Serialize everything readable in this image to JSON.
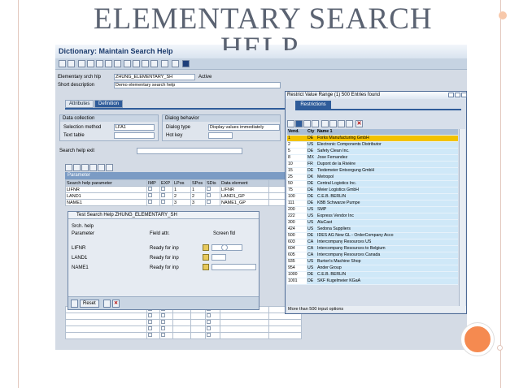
{
  "slide": {
    "title_line1": "ELEMENTARY SEARCH",
    "title_line2": "HELP"
  },
  "window": {
    "title": "Dictionary: Maintain Search Help"
  },
  "header": {
    "elementary_label": "Elementary srch hlp",
    "elementary_value": "ZHUNG_ELEMENTARY_SH",
    "status": "Active",
    "short_desc_label": "Short description",
    "short_desc_value": "Demo elementary search help"
  },
  "tabs": [
    "Attributes",
    "Definition"
  ],
  "data_collection": {
    "title": "Data collection",
    "selection_method_label": "Selection method",
    "selection_method_value": "LFA1",
    "text_table_label": "Text table"
  },
  "dialog_behavior": {
    "title": "Dialog behavior",
    "dialog_type_label": "Dialog type",
    "dialog_type_value": "Display values immediately",
    "hot_key_label": "Hot key"
  },
  "search_help_exit_label": "Search help exit",
  "parameter": {
    "section_title": "Parameter",
    "columns": [
      "Search help parameter",
      "IMP",
      "EXP",
      "LPos",
      "SPos",
      "SDis",
      "Data element"
    ],
    "rows": [
      {
        "name": "LIFNR",
        "lpos": "1",
        "spos": "1",
        "element": "LIFNR"
      },
      {
        "name": "LAND1",
        "lpos": "2",
        "spos": "2",
        "element": "LAND1_GP"
      },
      {
        "name": "NAME1",
        "lpos": "3",
        "spos": "3",
        "element": "NAME1_GP"
      }
    ]
  },
  "test_dialog": {
    "title": "Test Search Help ZHUNG_ELEMENTARY_SH",
    "srch_help_label": "Srch. help",
    "col_parameter": "Parameter",
    "col_field_attr": "Field attr.",
    "col_screen_fld": "Screen fld",
    "rows": [
      {
        "param": "LIFNR",
        "attr": "Ready for inp"
      },
      {
        "param": "LAND1",
        "attr": "Ready for inp"
      },
      {
        "param": "NAME1",
        "attr": "Ready for inp"
      }
    ],
    "reset_label": "Reset"
  },
  "restrict": {
    "title": "Restrict Value Range (1)  500 Entries found",
    "tab": "Restrictions",
    "columns": [
      "Vend.",
      "Cty",
      "Name 1"
    ],
    "rows": [
      [
        "1",
        "DE",
        "Forks Manufacturing GmbH"
      ],
      [
        "2",
        "US",
        "Electronic Components Distributor"
      ],
      [
        "5",
        "DE",
        "Safety Clean Inc."
      ],
      [
        "8",
        "MX",
        "Jose Fernandez"
      ],
      [
        "10",
        "FR",
        "Dupont de la Rivière"
      ],
      [
        "15",
        "DE",
        "Tiedemeier Entsorgung GmbH"
      ],
      [
        "25",
        "DK",
        "Metropol"
      ],
      [
        "50",
        "DE",
        "Central Logistics Inc."
      ],
      [
        "75",
        "DE",
        "Meier Logistics GmbH"
      ],
      [
        "100",
        "DE",
        "C.E.B. BERLIN"
      ],
      [
        "111",
        "DE",
        "KBB Schwarze Pumpe"
      ],
      [
        "200",
        "US",
        "SMP"
      ],
      [
        "222",
        "US",
        "Express Vendor Inc"
      ],
      [
        "300",
        "US",
        "AluCast"
      ],
      [
        "424",
        "US",
        "Sedona Suppliers"
      ],
      [
        "500",
        "DE",
        "IDES AG New GL - OrderCompany Acco"
      ],
      [
        "603",
        "CA",
        "Intercompany Resources US"
      ],
      [
        "604",
        "CA",
        "Intercompany Resources to Belgium"
      ],
      [
        "605",
        "CA",
        "Intercompany Resources Canada"
      ],
      [
        "935",
        "US",
        "Burton's Machine Shop"
      ],
      [
        "954",
        "US",
        "Ander Group"
      ],
      [
        "1000",
        "DE",
        "C.E.B. BERLIN"
      ],
      [
        "1001",
        "DE",
        "SKF Kugelmeier KGaA"
      ]
    ],
    "status": "More than  500 input options"
  }
}
